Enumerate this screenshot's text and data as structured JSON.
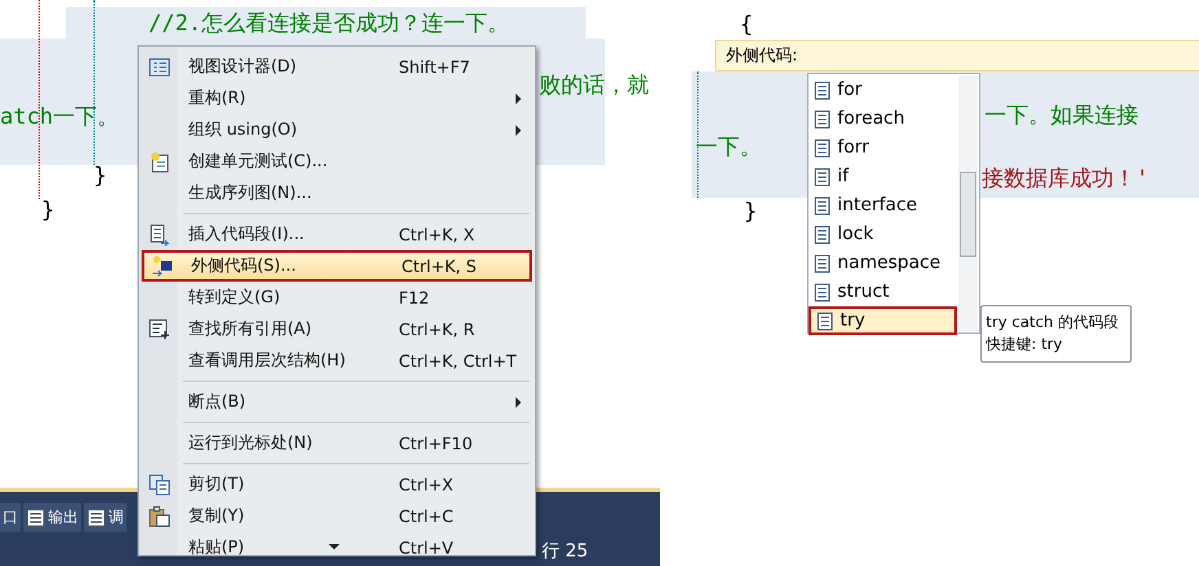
{
  "left_editor": {
    "code": [
      {
        "kind": "comment",
        "text": "//2.怎么看连接是否成功？连一下。"
      },
      {
        "kind": "comment",
        "text": "败的话，就"
      },
      {
        "kind": "comment",
        "text": "atch一下。"
      },
      {
        "kind": "brace",
        "text": "}"
      },
      {
        "kind": "brace",
        "text": "}"
      }
    ],
    "status_bar": {
      "tabs": [
        "口",
        "输出",
        "调"
      ],
      "position": "行 25"
    }
  },
  "context_menu": {
    "items": [
      {
        "kind": "item",
        "label": "视图设计器(D)",
        "shortcut": "Shift+F7",
        "submenu": false,
        "selected": false
      },
      {
        "kind": "item",
        "label": "重构(R)",
        "submenu": true,
        "selected": false
      },
      {
        "kind": "item",
        "label": "组织 using(O)",
        "submenu": true,
        "selected": false
      },
      {
        "kind": "item",
        "label": "创建单元测试(C)...",
        "submenu": false,
        "selected": false
      },
      {
        "kind": "item",
        "label": "生成序列图(N)...",
        "submenu": false,
        "selected": false
      },
      {
        "kind": "separator"
      },
      {
        "kind": "item",
        "label": "插入代码段(I)...",
        "shortcut": "Ctrl+K, X",
        "submenu": false,
        "selected": false
      },
      {
        "kind": "item",
        "label": "外侧代码(S)...",
        "shortcut": "Ctrl+K, S",
        "submenu": false,
        "selected": true
      },
      {
        "kind": "item",
        "label": "转到定义(G)",
        "shortcut": "F12",
        "submenu": false,
        "selected": false
      },
      {
        "kind": "item",
        "label": "查找所有引用(A)",
        "shortcut": "Ctrl+K, R",
        "submenu": false,
        "selected": false
      },
      {
        "kind": "item",
        "label": "查看调用层次结构(H)",
        "shortcut": "Ctrl+K, Ctrl+T",
        "submenu": false,
        "selected": false
      },
      {
        "kind": "separator"
      },
      {
        "kind": "item",
        "label": "断点(B)",
        "submenu": true,
        "selected": false
      },
      {
        "kind": "separator"
      },
      {
        "kind": "item",
        "label": "运行到光标处(N)",
        "shortcut": "Ctrl+F10",
        "submenu": false,
        "selected": false
      },
      {
        "kind": "separator"
      },
      {
        "kind": "item",
        "label": "剪切(T)",
        "shortcut": "Ctrl+X",
        "submenu": false,
        "selected": false
      },
      {
        "kind": "item",
        "label": "复制(Y)",
        "shortcut": "Ctrl+C",
        "submenu": false,
        "selected": false
      },
      {
        "kind": "item",
        "label": "粘贴(P)",
        "shortcut": "Ctrl+V",
        "submenu": false,
        "selected": false
      }
    ]
  },
  "right_editor": {
    "code": [
      {
        "kind": "brace",
        "text": "{"
      },
      {
        "kind": "comment",
        "text": "一下。如果连接"
      },
      {
        "kind": "comment",
        "text": "一下。"
      },
      {
        "kind": "string",
        "text": "接数据库成功！'"
      },
      {
        "kind": "brace",
        "text": "}"
      }
    ],
    "surround_bar": {
      "label": "外侧代码:"
    },
    "snippets": [
      {
        "label": "for",
        "selected": false
      },
      {
        "label": "foreach",
        "selected": false
      },
      {
        "label": "forr",
        "selected": false
      },
      {
        "label": "if",
        "selected": false
      },
      {
        "label": "interface",
        "selected": false
      },
      {
        "label": "lock",
        "selected": false
      },
      {
        "label": "namespace",
        "selected": false
      },
      {
        "label": "struct",
        "selected": false
      },
      {
        "label": "try",
        "selected": true
      }
    ],
    "tooltip": {
      "description": "try catch 的代码段",
      "shortcut": "快捷键: try"
    }
  }
}
